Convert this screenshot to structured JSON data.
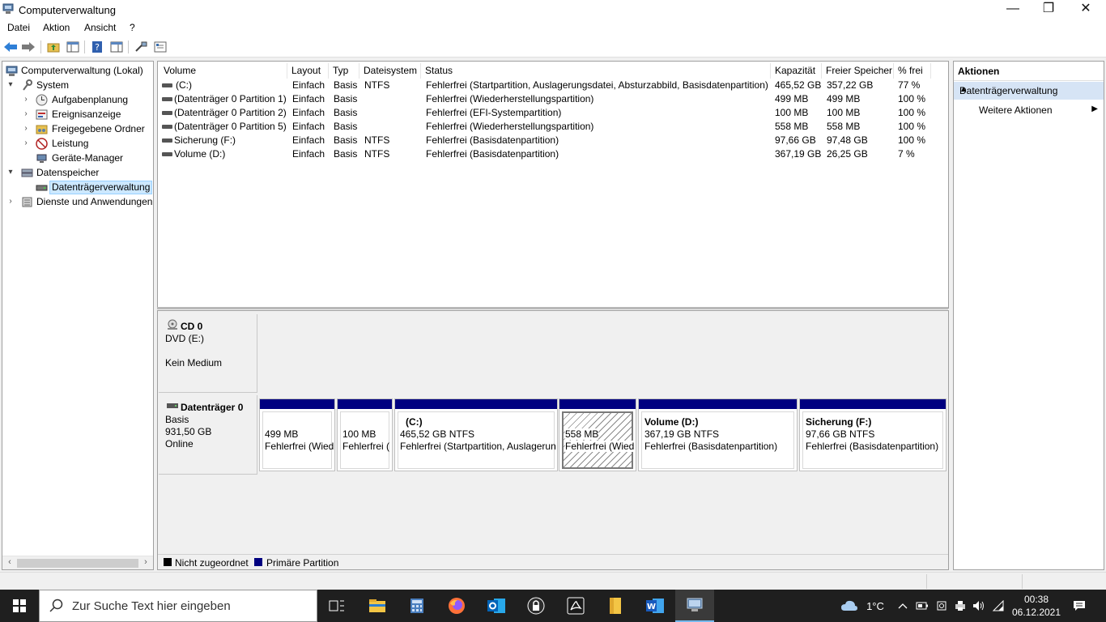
{
  "window": {
    "title": "Computerverwaltung",
    "minimize": "—",
    "restore": "❐",
    "close": "✕"
  },
  "menu": [
    "Datei",
    "Aktion",
    "Ansicht",
    "?"
  ],
  "tree": {
    "root": "Computerverwaltung (Lokal)",
    "system": "System",
    "aufgabenplanung": "Aufgabenplanung",
    "ereignisanzeige": "Ereignisanzeige",
    "freigegebene_ordner": "Freigegebene Ordner",
    "leistung": "Leistung",
    "geraete_manager": "Geräte-Manager",
    "datenspeicher": "Datenspeicher",
    "datentraegerverwaltung": "Datenträgerverwaltung",
    "dienste": "Dienste und Anwendungen"
  },
  "volume_list": {
    "columns": [
      "Volume",
      "Layout",
      "Typ",
      "Dateisystem",
      "Status",
      "Kapazität",
      "Freier Speicher",
      "% frei"
    ],
    "rows": [
      {
        "volume": "(C:)",
        "layout": "Einfach",
        "typ": "Basis",
        "fs": "NTFS",
        "status": "Fehlerfrei (Startpartition, Auslagerungsdatei, Absturzabbild, Basisdatenpartition)",
        "kapazitaet": "465,52 GB",
        "frei": "357,22 GB",
        "prozent": "77 %"
      },
      {
        "volume": "(Datenträger 0 Partition 1)",
        "layout": "Einfach",
        "typ": "Basis",
        "fs": "",
        "status": "Fehlerfrei (Wiederherstellungspartition)",
        "kapazitaet": "499 MB",
        "frei": "499 MB",
        "prozent": "100 %"
      },
      {
        "volume": "(Datenträger 0 Partition 2)",
        "layout": "Einfach",
        "typ": "Basis",
        "fs": "",
        "status": "Fehlerfrei (EFI-Systempartition)",
        "kapazitaet": "100 MB",
        "frei": "100 MB",
        "prozent": "100 %"
      },
      {
        "volume": "(Datenträger 0 Partition 5)",
        "layout": "Einfach",
        "typ": "Basis",
        "fs": "",
        "status": "Fehlerfrei (Wiederherstellungspartition)",
        "kapazitaet": "558 MB",
        "frei": "558 MB",
        "prozent": "100 %"
      },
      {
        "volume": "Sicherung (F:)",
        "layout": "Einfach",
        "typ": "Basis",
        "fs": "NTFS",
        "status": "Fehlerfrei (Basisdatenpartition)",
        "kapazitaet": "97,66 GB",
        "frei": "97,48 GB",
        "prozent": "100 %"
      },
      {
        "volume": "Volume (D:)",
        "layout": "Einfach",
        "typ": "Basis",
        "fs": "NTFS",
        "status": "Fehlerfrei (Basisdatenpartition)",
        "kapazitaet": "367,19 GB",
        "frei": "26,25 GB",
        "prozent": "7 %"
      }
    ]
  },
  "cd0": {
    "name": "CD 0",
    "drive": "DVD (E:)",
    "medium": "Kein Medium"
  },
  "disk0": {
    "name": "Datenträger 0",
    "type": "Basis",
    "size": "931,50 GB",
    "state": "Online",
    "partitions": [
      {
        "name": "",
        "size": "499 MB",
        "status": "Fehlerfrei (Wied"
      },
      {
        "name": "",
        "size": "100 MB",
        "status": "Fehlerfrei ("
      },
      {
        "name": "(C:)",
        "size": "465,52 GB NTFS",
        "status": "Fehlerfrei (Startpartition, Auslagerun"
      },
      {
        "name": "",
        "size": "558 MB",
        "status": "Fehlerfrei (Wied"
      },
      {
        "name": "Volume  (D:)",
        "size": "367,19 GB NTFS",
        "status": "Fehlerfrei (Basisdatenpartition)"
      },
      {
        "name": "Sicherung  (F:)",
        "size": "97,66 GB NTFS",
        "status": "Fehlerfrei (Basisdatenpartition)"
      }
    ]
  },
  "legend": {
    "unallocated": "Nicht zugeordnet",
    "primary": "Primäre Partition",
    "unallocated_color": "#000000",
    "primary_color": "#000080"
  },
  "actions": {
    "title": "Aktionen",
    "section": "Datenträgerverwaltung",
    "more": "Weitere Aktionen"
  },
  "taskbar": {
    "search_placeholder": "Zur Suche Text hier eingeben",
    "temperature": "1°C",
    "time": "00:38",
    "date": "06.12.2021"
  }
}
